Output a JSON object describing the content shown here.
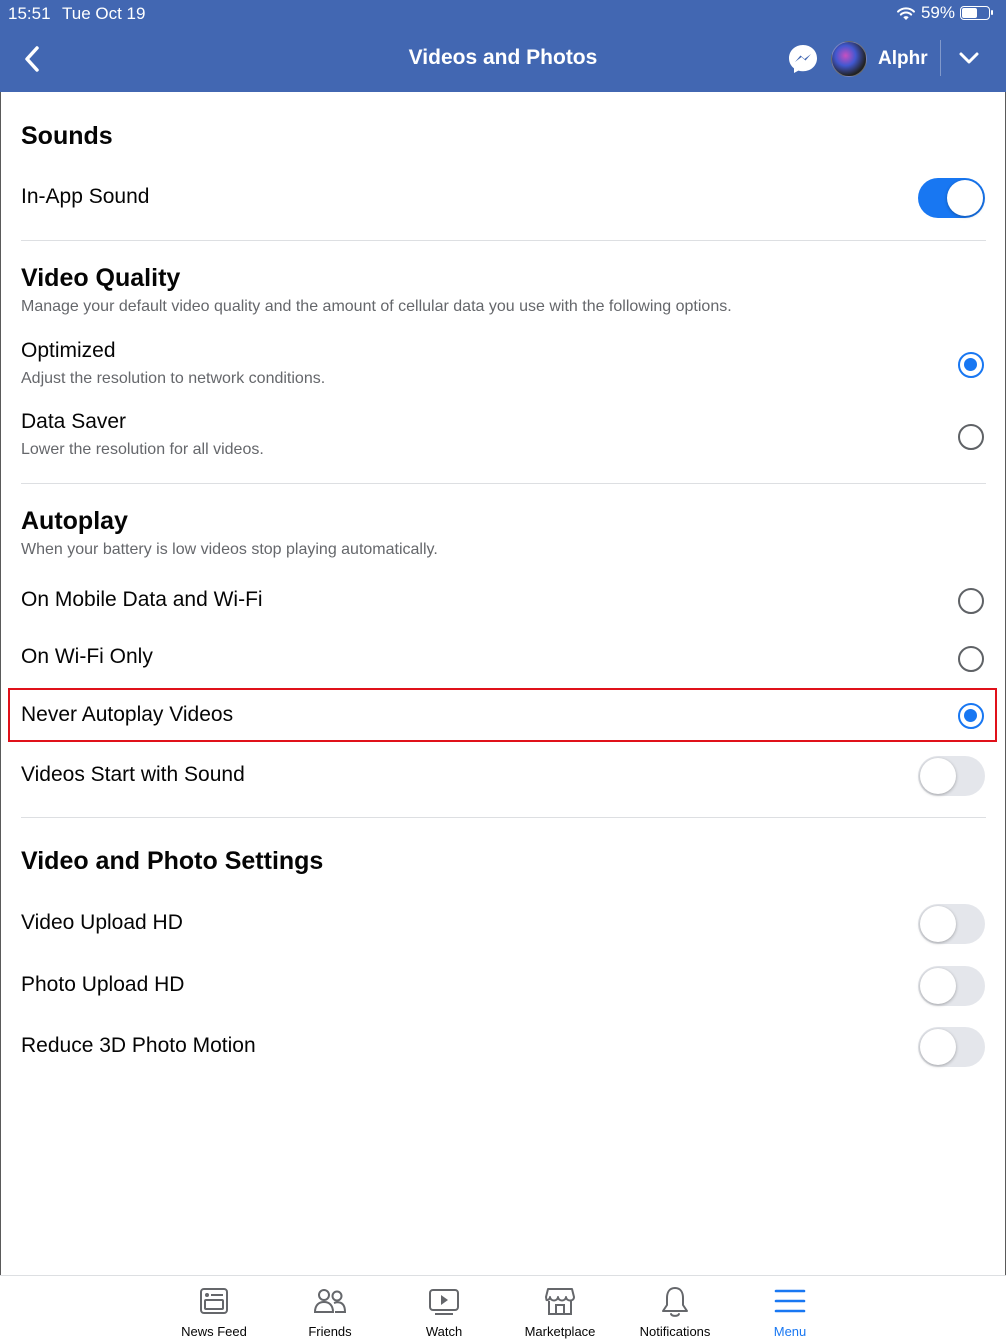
{
  "status_bar": {
    "time": "15:51",
    "date": "Tue Oct 19",
    "battery": "59%",
    "battery_level": 0.59
  },
  "header": {
    "title": "Videos and Photos",
    "account_name": "Alphr"
  },
  "sections": {
    "sounds": {
      "title": "Sounds",
      "in_app_sound": {
        "label": "In-App Sound",
        "on": true
      }
    },
    "video_quality": {
      "title": "Video Quality",
      "description": "Manage your default video quality and the amount of cellular data you use with the following options.",
      "optimized": {
        "label": "Optimized",
        "sublabel": "Adjust the resolution to network conditions.",
        "selected": true
      },
      "data_saver": {
        "label": "Data Saver",
        "sublabel": "Lower the resolution for all videos.",
        "selected": false
      }
    },
    "autoplay": {
      "title": "Autoplay",
      "description": "When your battery is low videos stop playing automatically.",
      "mobile_wifi": {
        "label": "On Mobile Data and Wi-Fi",
        "selected": false
      },
      "wifi_only": {
        "label": "On Wi-Fi Only",
        "selected": false
      },
      "never": {
        "label": "Never Autoplay Videos",
        "selected": true
      },
      "start_with_sound": {
        "label": "Videos Start with Sound",
        "on": false
      }
    },
    "video_photo_settings": {
      "title": "Video and Photo Settings",
      "video_upload_hd": {
        "label": "Video Upload HD",
        "on": false
      },
      "photo_upload_hd": {
        "label": "Photo Upload HD",
        "on": false
      },
      "reduce_3d_motion": {
        "label": "Reduce 3D Photo Motion",
        "on": false
      }
    }
  },
  "tabbar": {
    "news_feed": "News Feed",
    "friends": "Friends",
    "watch": "Watch",
    "marketplace": "Marketplace",
    "notifications": "Notifications",
    "menu": "Menu",
    "active": "Menu"
  },
  "colors": {
    "header_bg": "#4267b2",
    "accent": "#1877f2",
    "highlight": "#e0111a"
  },
  "icons": [
    "back-chevron-icon",
    "messenger-icon",
    "dropdown-chevron-icon",
    "wifi-icon",
    "battery-icon",
    "news-feed-icon",
    "friends-icon",
    "watch-icon",
    "marketplace-icon",
    "notifications-icon",
    "menu-icon"
  ]
}
